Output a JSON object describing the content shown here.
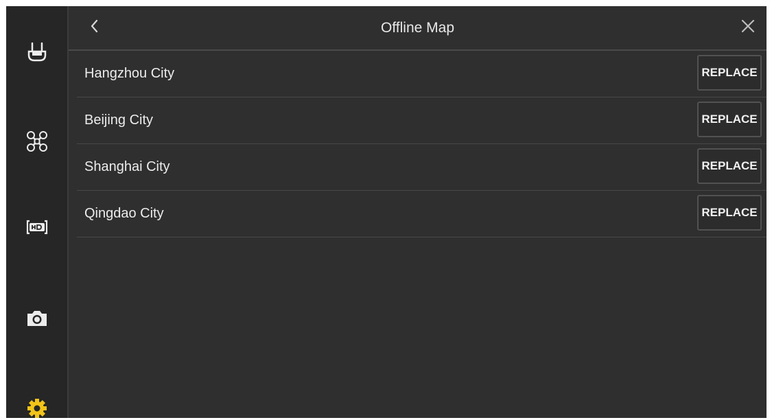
{
  "header": {
    "title": "Offline Map"
  },
  "sidebar": {
    "items": [
      {
        "icon": "remote-controller-icon",
        "active": false
      },
      {
        "icon": "drone-icon",
        "active": false
      },
      {
        "icon": "hd-transmission-icon",
        "active": false
      },
      {
        "icon": "camera-icon",
        "active": false
      },
      {
        "icon": "gear-icon",
        "active": true
      }
    ]
  },
  "cities": [
    {
      "name": "Hangzhou City",
      "action": "REPLACE"
    },
    {
      "name": "Beijing City",
      "action": "REPLACE"
    },
    {
      "name": "Shanghai City",
      "action": "REPLACE"
    },
    {
      "name": "Qingdao City",
      "action": "REPLACE"
    }
  ],
  "colors": {
    "background": "#2f2f2f",
    "sidebar": "#262626",
    "icon": "#ececec",
    "active_icon": "#f2c318",
    "text": "#ececec"
  }
}
